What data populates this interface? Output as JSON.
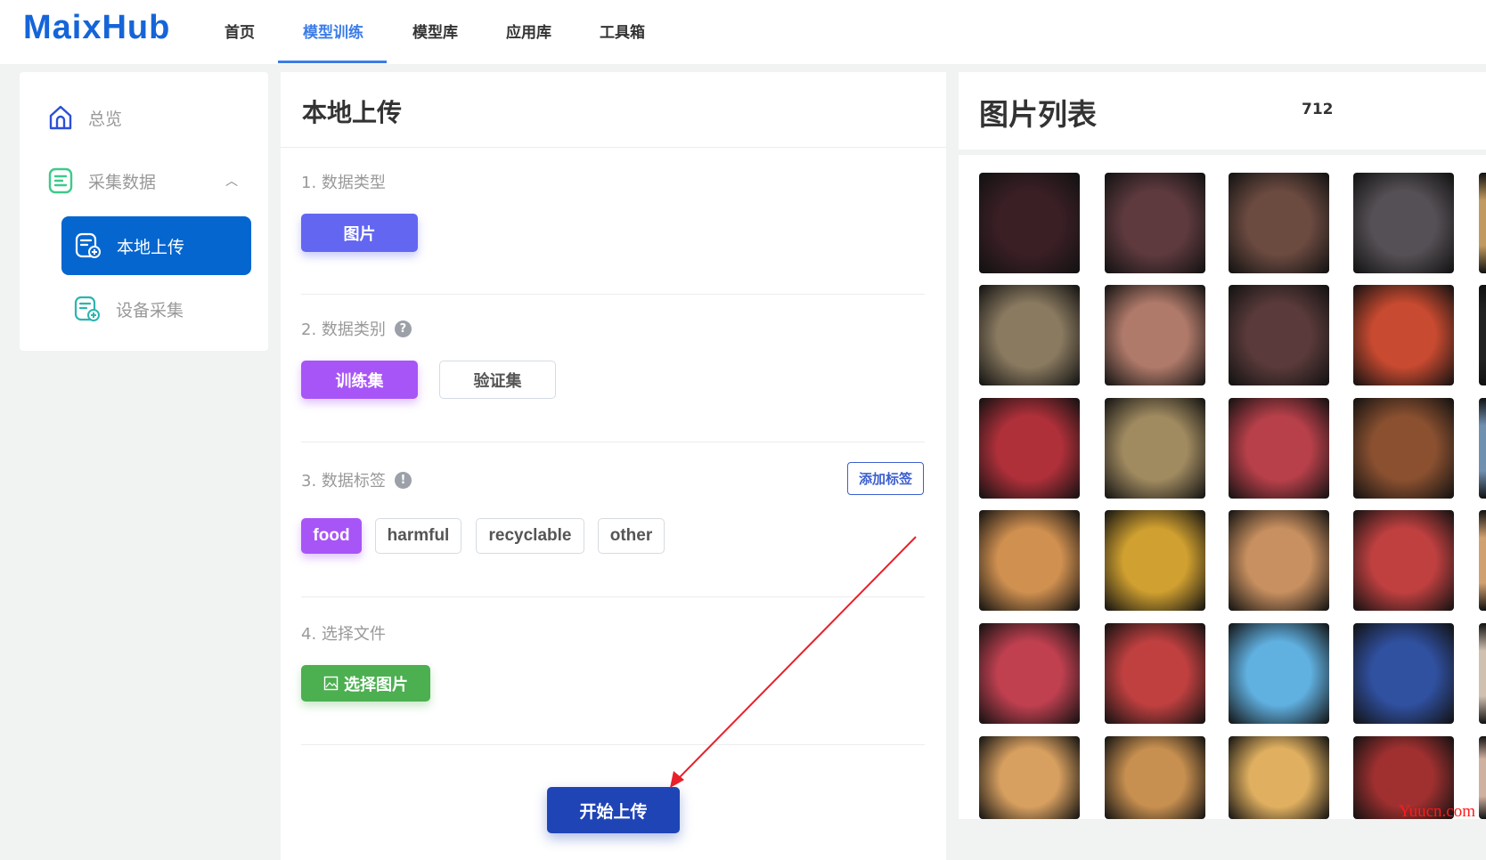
{
  "header": {
    "logo": "MaixHub",
    "nav": [
      {
        "label": "首页"
      },
      {
        "label": "模型训练",
        "active": true
      },
      {
        "label": "模型库"
      },
      {
        "label": "应用库"
      },
      {
        "label": "工具箱"
      }
    ]
  },
  "sidebar": {
    "items": [
      {
        "label": "总览",
        "icon": "home-icon"
      },
      {
        "label": "采集数据",
        "icon": "list-icon",
        "expanded": true
      },
      {
        "label": "本地上传",
        "icon": "upload-file-icon",
        "active": true
      },
      {
        "label": "设备采集",
        "icon": "device-file-icon"
      }
    ]
  },
  "main": {
    "title": "本地上传",
    "step1": {
      "label": "1. 数据类型",
      "option": "图片"
    },
    "step2": {
      "label": "2. 数据类别",
      "help": "?",
      "options": [
        "训练集",
        "验证集"
      ],
      "selected": "训练集"
    },
    "step3": {
      "label": "3. 数据标签",
      "info": "!",
      "add_label": "添加标签",
      "tags": [
        "food",
        "harmful",
        "recyclable",
        "other"
      ],
      "selected": "food"
    },
    "step4": {
      "label": "4. 选择文件",
      "button": "选择图片"
    },
    "submit": "开始上传"
  },
  "image_list": {
    "title": "图片列表",
    "count": "712",
    "thumb_colors": [
      "#3a1f25",
      "#5e3a3e",
      "#6b4a40",
      "#555055",
      "#c09a60",
      "#8a7a60",
      "#b07a6a",
      "#5a3a3a",
      "#c84a30",
      "#222222",
      "#b0303a",
      "#a08a60",
      "#b8404a",
      "#8a5030",
      "#7090b0",
      "#d09050",
      "#d0a030",
      "#c89060",
      "#c04040",
      "#d0a070",
      "#c04050",
      "#c04040",
      "#60b0e0",
      "#3050a0",
      "#d0c0b0",
      "#d8a060",
      "#c89050",
      "#e0b060",
      "#a03030",
      "#d0b0a0"
    ]
  },
  "watermark": "Yuucn.com",
  "colors": {
    "brand": "#1565d8",
    "active_nav": "#3b7ce8",
    "primary": "#6366f1",
    "tag_selected": "#a855f7",
    "select_file": "#4caf50",
    "submit": "#1f44b5",
    "annotation_arrow": "#e8202a"
  }
}
